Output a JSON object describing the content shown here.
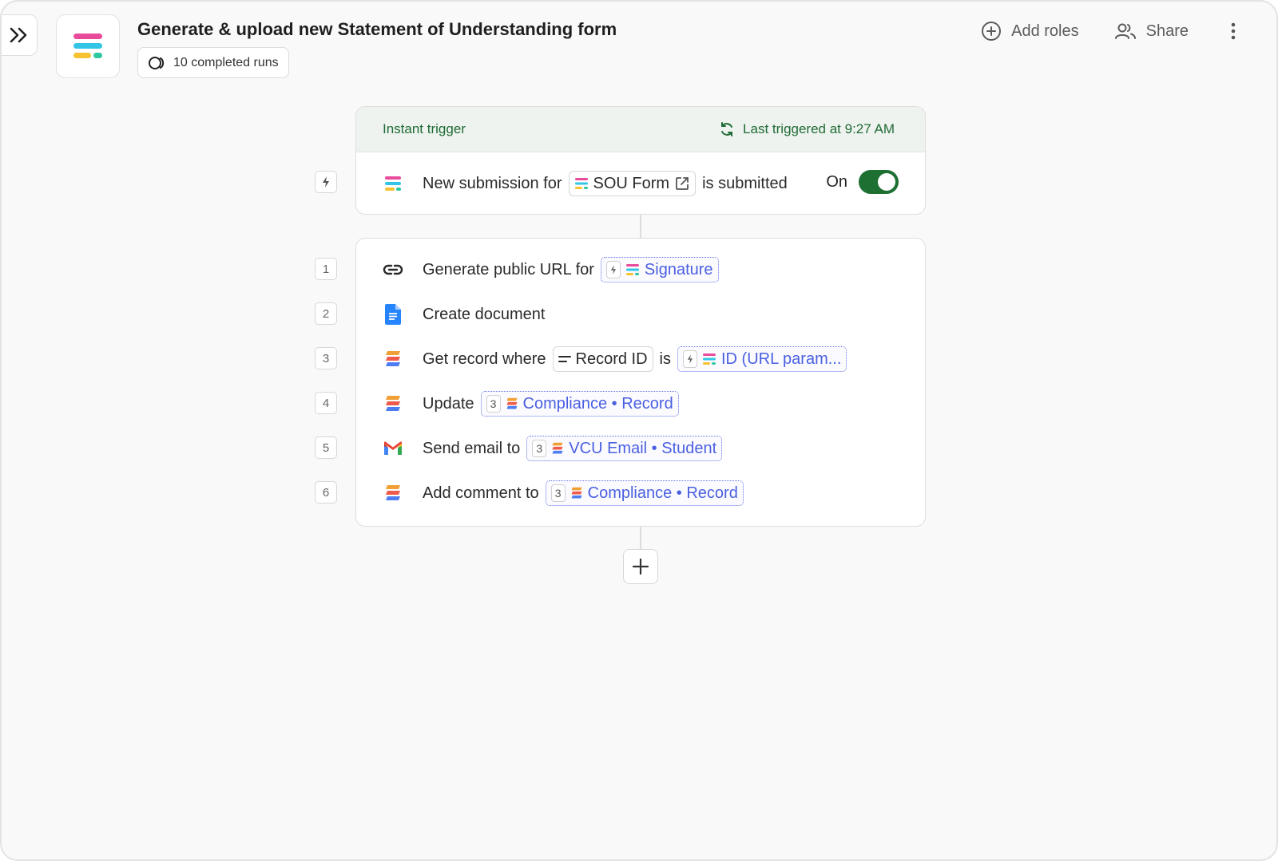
{
  "header": {
    "title": "Generate & upload new Statement of Understanding form",
    "runs_label": "10 completed runs",
    "add_roles": "Add roles",
    "share": "Share"
  },
  "trigger": {
    "type_label": "Instant trigger",
    "last_triggered": "Last triggered at 9:27 AM",
    "text_before": "New submission for",
    "form_chip": "SOU Form",
    "text_after": "is submitted",
    "toggle_label": "On",
    "toggle_on": true
  },
  "steps": [
    {
      "num": "1",
      "icon": "link-icon",
      "prefix": "Generate public URL for",
      "var_chip": "Signature"
    },
    {
      "num": "2",
      "icon": "google-docs-icon",
      "prefix": "Create document"
    },
    {
      "num": "3",
      "icon": "stack-icon",
      "prefix": "Get record where",
      "field_chip": "Record ID",
      "middle": "is",
      "var_chip": "ID (URL param..."
    },
    {
      "num": "4",
      "icon": "stack-icon",
      "prefix": "Update",
      "ref": "3",
      "var_chip": "Compliance • Record"
    },
    {
      "num": "5",
      "icon": "gmail-icon",
      "prefix": "Send email to",
      "ref": "3",
      "var_chip": "VCU Email • Student"
    },
    {
      "num": "6",
      "icon": "stack-icon",
      "prefix": "Add comment to",
      "ref": "3",
      "var_chip": "Compliance • Record"
    }
  ],
  "colors": {
    "accent_green": "#1d6f32",
    "variable_blue": "#4a5fe0",
    "brand_pink": "#e94b9b",
    "brand_cyan": "#33c4e6",
    "brand_yellow": "#f6c232",
    "brand_teal": "#2ec9a0"
  }
}
